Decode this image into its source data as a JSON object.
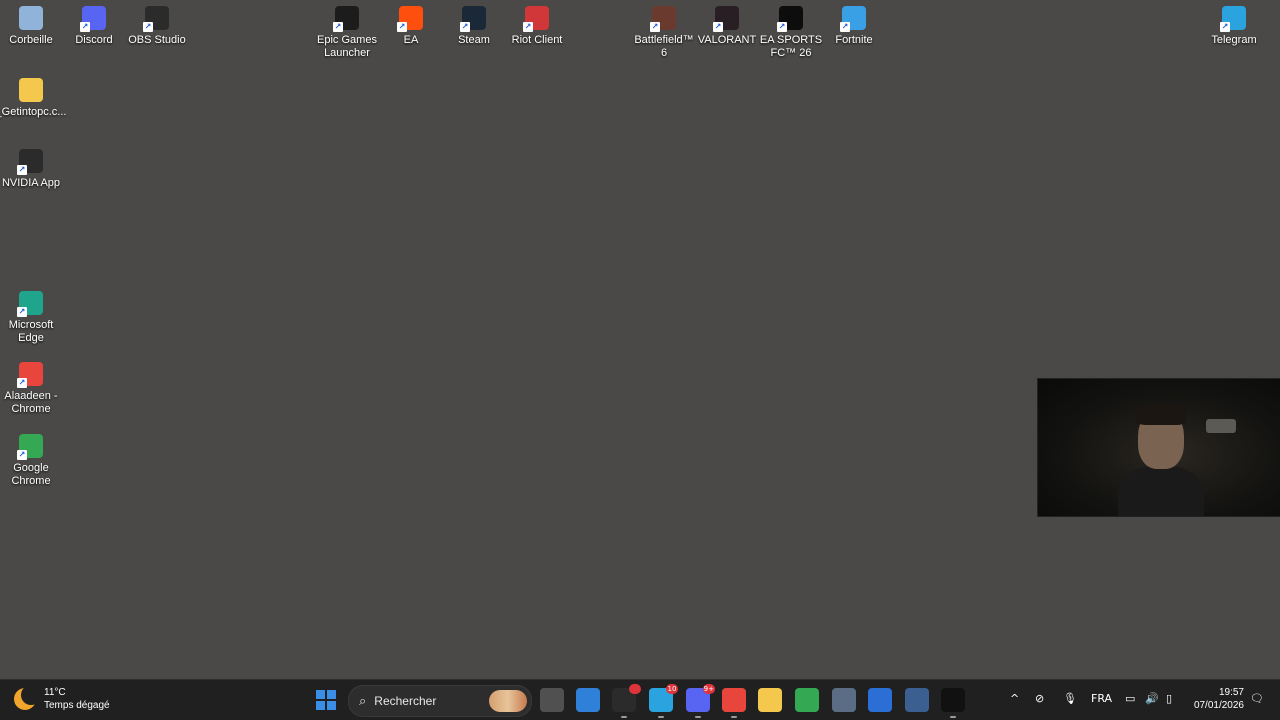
{
  "desktop": {
    "icons": [
      {
        "label": "Corbeille",
        "icon": "recycle-bin-icon",
        "color": "#8fb3d9"
      },
      {
        "label": "Discord",
        "icon": "discord-icon",
        "color": "#5865f2"
      },
      {
        "label": "OBS Studio",
        "icon": "obs-icon",
        "color": "#2b2b2b"
      },
      {
        "label": "Epic Games\nLauncher",
        "icon": "epic-games-icon",
        "color": "#1c1c1c"
      },
      {
        "label": "EA",
        "icon": "ea-icon",
        "color": "#ff4f0f"
      },
      {
        "label": "Steam",
        "icon": "steam-icon",
        "color": "#1b2838"
      },
      {
        "label": "Riot Client",
        "icon": "riot-icon",
        "color": "#d13639"
      },
      {
        "label": "Battlefield™\n6",
        "icon": "battlefield-icon",
        "color": "#6b3a2e"
      },
      {
        "label": "VALORANT",
        "icon": "valorant-icon",
        "color": "#2a1e25"
      },
      {
        "label": "EA SPORTS\nFC™ 26",
        "icon": "ea-sports-fc-icon",
        "color": "#0d0d0d"
      },
      {
        "label": "Fortnite",
        "icon": "fortnite-icon",
        "color": "#3aa0e6"
      },
      {
        "label": "Telegram",
        "icon": "telegram-icon",
        "color": "#2aa3df"
      },
      {
        "label": "_Getintopc.c...",
        "icon": "folder-icon",
        "color": "#f4c84d"
      },
      {
        "label": "NVIDIA App",
        "icon": "nvidia-icon",
        "color": "#2b2b2b"
      },
      {
        "label": "Microsoft\nEdge",
        "icon": "edge-icon",
        "color": "#1fa58c"
      },
      {
        "label": "Alaadeen -\nChrome",
        "icon": "chrome-profile-icon",
        "color": "#e8453c"
      },
      {
        "label": "Google\nChrome",
        "icon": "chrome-icon",
        "color": "#34a853"
      }
    ]
  },
  "taskbar": {
    "weather": {
      "temp": "11°C",
      "desc": "Temps dégagé"
    },
    "search_placeholder": "Rechercher",
    "apps": [
      {
        "name": "start-button",
        "icon": "windows-logo-icon",
        "color": "#3a8ee6"
      },
      {
        "name": "task-view",
        "icon": "task-view-icon",
        "color": "#505050"
      },
      {
        "name": "notepad",
        "icon": "notepad-icon",
        "color": "#2f80d8"
      },
      {
        "name": "obs",
        "icon": "obs-icon",
        "color": "#2b2b2b",
        "badge": "",
        "running": true
      },
      {
        "name": "telegram",
        "icon": "telegram-icon",
        "color": "#2aa3df",
        "badge": "10",
        "running": true
      },
      {
        "name": "discord",
        "icon": "discord-icon",
        "color": "#5865f2",
        "badge": "9+",
        "running": true
      },
      {
        "name": "chrome-profile",
        "icon": "chrome-profile-icon",
        "color": "#e8453c",
        "running": true
      },
      {
        "name": "file-explorer",
        "icon": "folder-icon",
        "color": "#f4c84d"
      },
      {
        "name": "chrome",
        "icon": "chrome-icon",
        "color": "#34a853"
      },
      {
        "name": "settings",
        "icon": "gear-icon",
        "color": "#5a6d85"
      },
      {
        "name": "store",
        "icon": "store-icon",
        "color": "#2b6fd6"
      },
      {
        "name": "calculator",
        "icon": "calculator-icon",
        "color": "#3b5f90"
      },
      {
        "name": "capcut",
        "icon": "capcut-icon",
        "color": "#111111",
        "running": true
      }
    ],
    "tray": {
      "chevron": "^",
      "language": "FRA",
      "time": "19:57",
      "date": "07/01/2026"
    }
  }
}
